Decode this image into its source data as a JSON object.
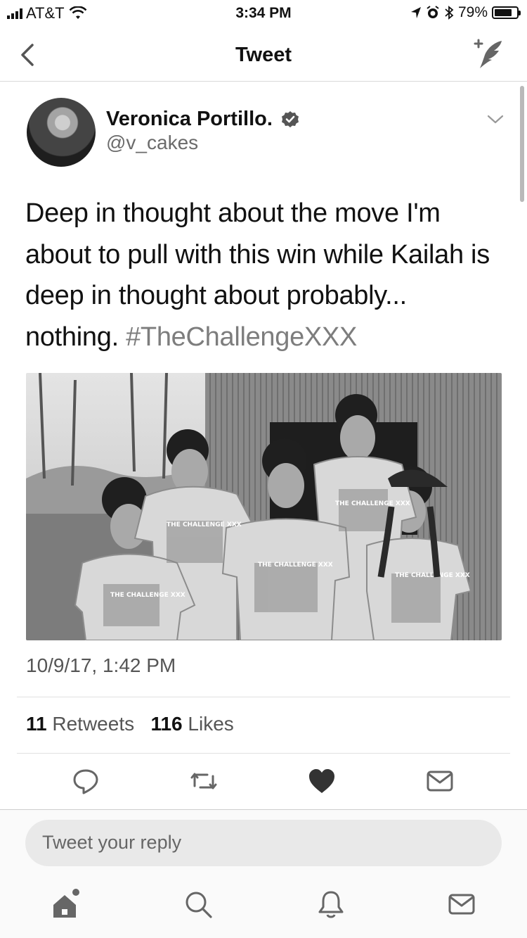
{
  "status_bar": {
    "carrier": "AT&T",
    "time": "3:34 PM",
    "battery": "79%",
    "battery_level": 0.79,
    "icons": [
      "signal-icon",
      "wifi-icon",
      "location-icon",
      "alarm-icon",
      "bluetooth-icon",
      "battery-icon"
    ]
  },
  "nav": {
    "title": "Tweet",
    "icons": [
      "back-chevron-icon",
      "compose-tweet-icon"
    ]
  },
  "tweet": {
    "author_name": "Veronica Portillo.",
    "handle": "@v_cakes",
    "verified": true,
    "text_lines": [
      "Deep in thought about the move I'm",
      "about to pull with this win while Kailah is",
      "deep in thought about probably...",
      "nothing."
    ],
    "hashtag": "#TheChallengeXXX",
    "timestamp": "10/9/17, 1:42 PM",
    "retweets_count": "11",
    "retweets_label": "Retweets",
    "likes_count": "116",
    "likes_label": "Likes",
    "photo_shirt_text": "THE CHALLENGE XXX"
  },
  "actions": [
    "reply-icon",
    "retweet-icon",
    "like-icon",
    "direct-message-icon"
  ],
  "reply": {
    "placeholder": "Tweet your reply"
  },
  "tab_bar": [
    "home-icon",
    "search-icon",
    "notifications-icon",
    "messages-icon"
  ],
  "colors": {
    "text": "#111111",
    "secondary_text": "#6b6b6b",
    "hashtag": "#7d7d7d",
    "divider": "#e1e1e1",
    "reply_box": "#e9e9e9"
  }
}
